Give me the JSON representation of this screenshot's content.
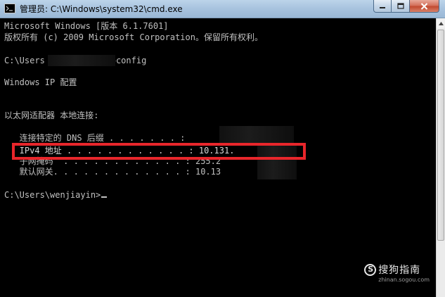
{
  "window": {
    "title": "管理员: C:\\Windows\\system32\\cmd.exe",
    "icon": "cmd-icon"
  },
  "controls": {
    "minimize": "minimize-icon",
    "maximize": "maximize-icon",
    "close": "close-icon"
  },
  "console": {
    "lines": [
      "Microsoft Windows [版本 6.1.7601]",
      "版权所有 (c) 2009 Microsoft Corporation。保留所有权利。",
      "C:\\Users            .pconfig",
      "Windows IP 配置",
      "以太网适配器 本地连接:",
      "   连接特定的 DNS 后缀 . . . . . . . :",
      "   IPv4 地址 . . . . . . . . . . . . : 10.131.",
      "   子网掩码  . . . . . . . . . . . . : 255.2",
      "   默认网关. . . . . . . . . . . . . : 10.13",
      "C:\\Users\\wenjiayin>"
    ]
  },
  "annotation": {
    "color": "#e8262b"
  },
  "watermark": {
    "logo": "S",
    "brand": "搜狗指南",
    "domain": "zhinan.sogou.com"
  }
}
